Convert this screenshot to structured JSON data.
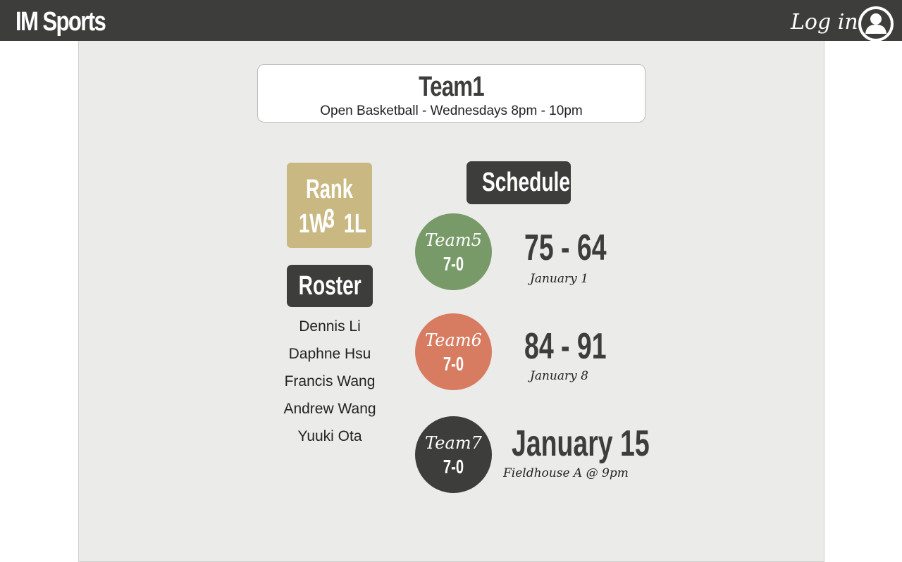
{
  "header": {
    "brand": "IM Sports",
    "login_label": "Log in",
    "user_icon": "user-circle-icon",
    "background_color": "#3d3d3b"
  },
  "team": {
    "name": "Team1",
    "league": "Open Basketball - Wednesdays 8pm - 10pm"
  },
  "standing": {
    "rank": "Rank 3",
    "record": "1W   1L",
    "color": "#c9b882"
  },
  "roster": {
    "title": "Roster",
    "players": [
      "Dennis Li",
      "Daphne Hsu",
      "Francis Wang",
      "Andrew Wang",
      "Yuuki Ota"
    ]
  },
  "schedule": {
    "title": "Schedule",
    "games": [
      {
        "opponent": "Team5",
        "opponent_record": "7-0",
        "result": "75 - 64",
        "detail": "January 1",
        "color": "#789a68"
      },
      {
        "opponent": "Team6",
        "opponent_record": "7-0",
        "result": "84 - 91",
        "detail": "January 8",
        "color": "#d87c61"
      },
      {
        "opponent": "Team7",
        "opponent_record": "7-0",
        "result": "January 15",
        "detail": "Fieldhouse A @ 9pm",
        "color": "#3d3d3b"
      }
    ]
  }
}
